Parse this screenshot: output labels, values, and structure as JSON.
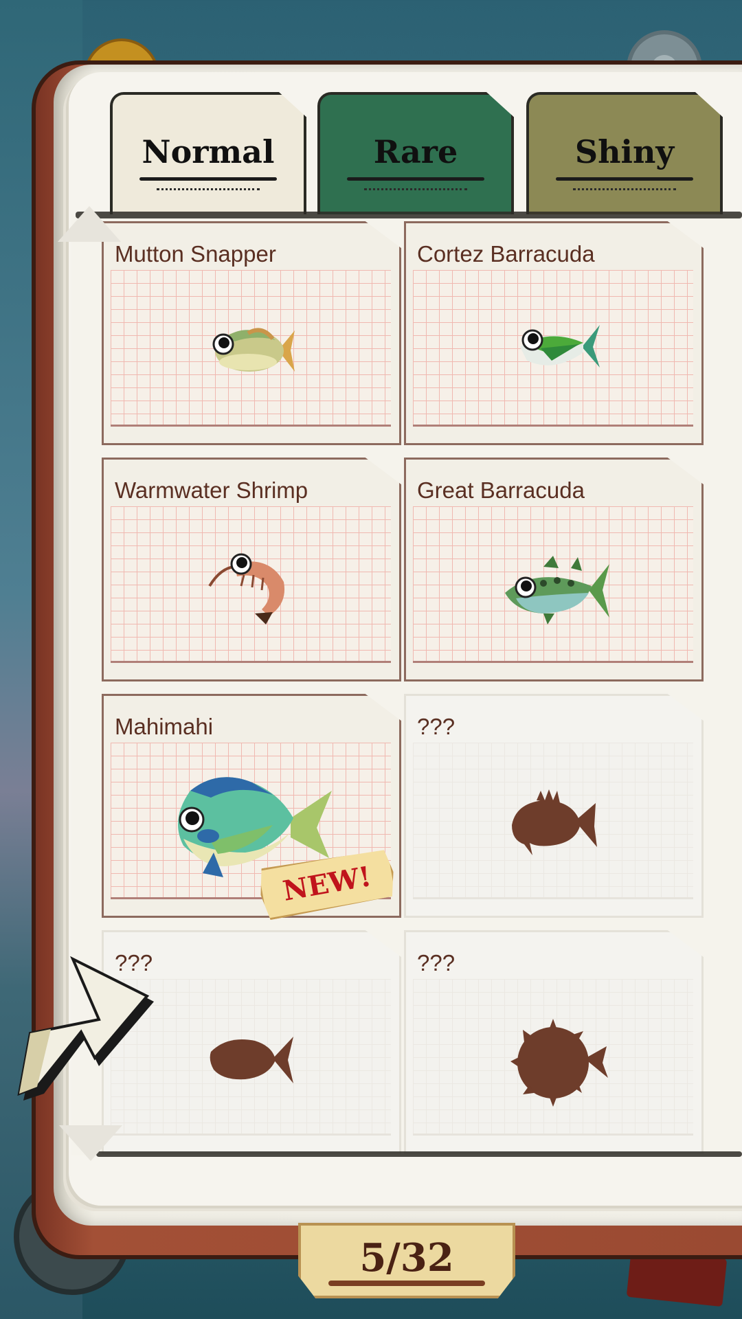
{
  "tabs": [
    {
      "label": "Normal",
      "state": "active"
    },
    {
      "label": "Rare",
      "state": "inactive"
    },
    {
      "label": "Shiny",
      "state": "inactive"
    }
  ],
  "catalog": [
    {
      "name": "Mutton Snapper",
      "discovered": true,
      "icon": "mutton-snapper-icon"
    },
    {
      "name": "Cortez Barracuda",
      "discovered": true,
      "icon": "cortez-barracuda-icon"
    },
    {
      "name": "Warmwater Shrimp",
      "discovered": true,
      "icon": "warmwater-shrimp-icon"
    },
    {
      "name": "Great Barracuda",
      "discovered": true,
      "icon": "great-barracuda-icon"
    },
    {
      "name": "Mahimahi",
      "discovered": true,
      "icon": "mahimahi-icon",
      "badge": "NEW!"
    },
    {
      "name": "???",
      "discovered": false,
      "icon": "rockfish-silhouette-icon"
    },
    {
      "name": "???",
      "discovered": false,
      "icon": "fish-silhouette-icon"
    },
    {
      "name": "???",
      "discovered": false,
      "icon": "pufferfish-silhouette-icon"
    }
  ],
  "page_counter": "5/32",
  "colors": {
    "tab_normal": "#efeadb",
    "tab_rare": "#2f7050",
    "tab_shiny": "#8c8955",
    "silhouette": "#6e3d2b",
    "cover": "#9a4a32",
    "new_text": "#c0141c"
  }
}
